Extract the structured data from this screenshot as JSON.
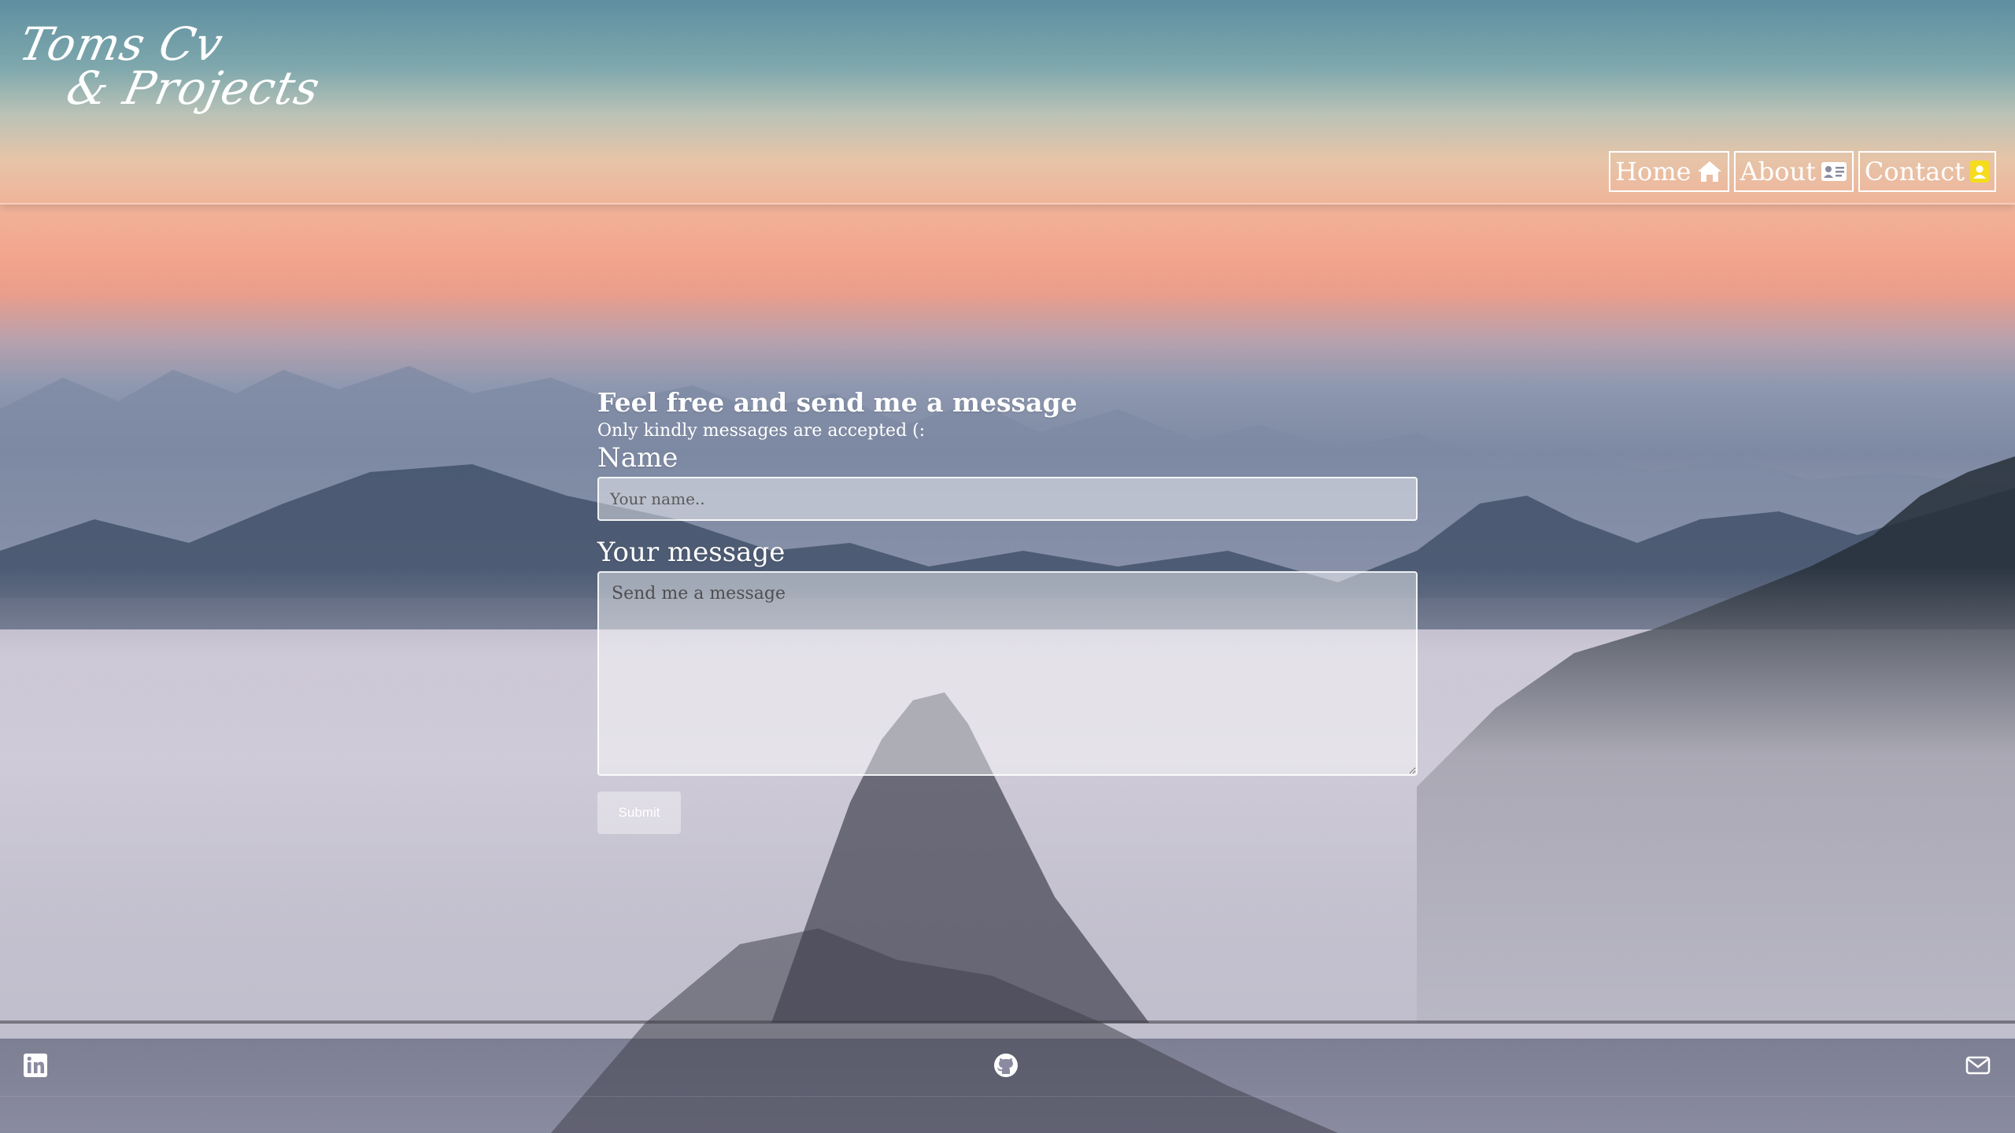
{
  "logo": {
    "line1": "Toms Cv",
    "line2": "& Projects"
  },
  "nav": {
    "items": [
      {
        "label": "Home",
        "icon": "home-icon"
      },
      {
        "label": "About",
        "icon": "id-card-icon"
      },
      {
        "label": "Contact",
        "icon": "contact-icon"
      }
    ]
  },
  "form": {
    "heading": "Feel free and send me a message",
    "subheading": "Only kindly messages are accepted (:",
    "name_label": "Name",
    "name_placeholder": "Your name..",
    "message_label": "Your message",
    "message_placeholder": "Send me a message",
    "submit_label": "Submit"
  },
  "footer": {
    "icons": [
      "linkedin-icon",
      "github-icon",
      "mail-icon"
    ]
  },
  "colors": {
    "contact_icon_accent": "#f5dd1e",
    "text": "#ffffff"
  }
}
